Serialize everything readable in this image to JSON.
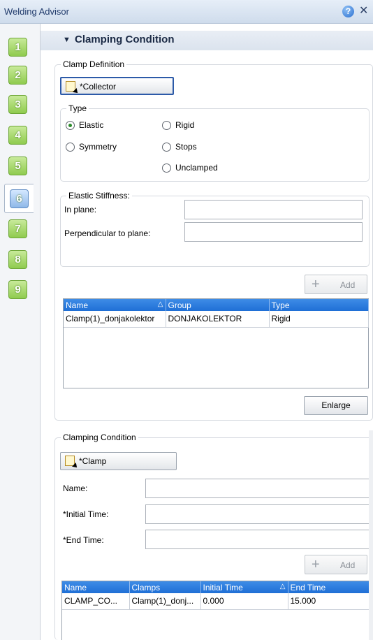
{
  "window": {
    "title": "Welding Advisor"
  },
  "steps": [
    "1",
    "2",
    "3",
    "4",
    "5",
    "6",
    "7",
    "8",
    "9"
  ],
  "active_step": "6",
  "section": {
    "title": "Clamping Condition"
  },
  "clamp_definition": {
    "label": "Clamp Definition",
    "collector_button": "*Collector",
    "type": {
      "label": "Type",
      "options": [
        "Elastic",
        "Rigid",
        "Symmetry",
        "Stops",
        "Unclamped"
      ],
      "selected": "Elastic"
    },
    "elastic_stiffness": {
      "label": "Elastic Stiffness:",
      "in_plane_label": "In plane:",
      "in_plane_value": "",
      "perpendicular_label": "Perpendicular to plane:",
      "perpendicular_value": ""
    },
    "add_button": "Add",
    "table": {
      "columns": [
        "Name",
        "Group",
        "Type"
      ],
      "rows": [
        [
          "Clamp(1)_donjakolektor",
          "DONJAKOLEKTOR",
          "Rigid"
        ]
      ]
    },
    "enlarge_button": "Enlarge"
  },
  "clamping_condition": {
    "label": "Clamping Condition",
    "clamp_button": "*Clamp",
    "name_label": "Name:",
    "name_value": "",
    "initial_time_label": "*Initial Time:",
    "initial_time_value": "",
    "end_time_label": "*End Time:",
    "end_time_value": "",
    "add_button": "Add",
    "table": {
      "columns": [
        "Name",
        "Clamps",
        "Initial Time",
        "End Time"
      ],
      "rows": [
        [
          "CLAMP_CO...",
          "Clamp(1)_donj...",
          "0.000",
          "15.000"
        ]
      ]
    }
  },
  "colors": {
    "header_blue": "#1f6fd6",
    "step_green": "#8fcb4e"
  },
  "icons": [
    "help-icon",
    "close-icon",
    "collector-icon",
    "plus-icon",
    "sort-icon"
  ]
}
